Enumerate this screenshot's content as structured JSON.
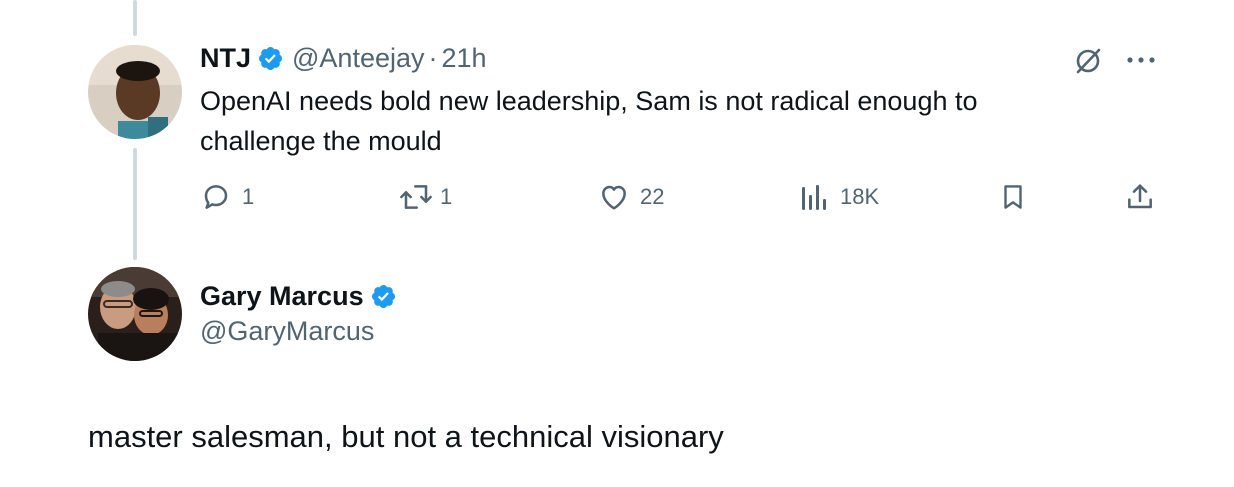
{
  "parent_tweet": {
    "display_name": "NTJ",
    "handle": "@Anteejay",
    "separator": "·",
    "time": "21h",
    "text_line1": "OpenAI needs bold new leadership, Sam is not radical enough to",
    "text_line2": "challenge the mould",
    "actions": {
      "replies": "1",
      "reposts": "1",
      "likes": "22",
      "views": "18K"
    },
    "icons": [
      "grok-icon",
      "more-icon",
      "reply-icon",
      "repost-icon",
      "like-icon",
      "views-icon",
      "bookmark-icon",
      "share-icon"
    ]
  },
  "main_tweet": {
    "display_name": "Gary Marcus",
    "handle": "@GaryMarcus",
    "text": "master salesman, but not a technical visionary"
  },
  "colors": {
    "text_primary": "#0f1419",
    "text_secondary": "#536471",
    "verified_blue": "#1d9bf0",
    "thread_line": "#cfd9de"
  }
}
